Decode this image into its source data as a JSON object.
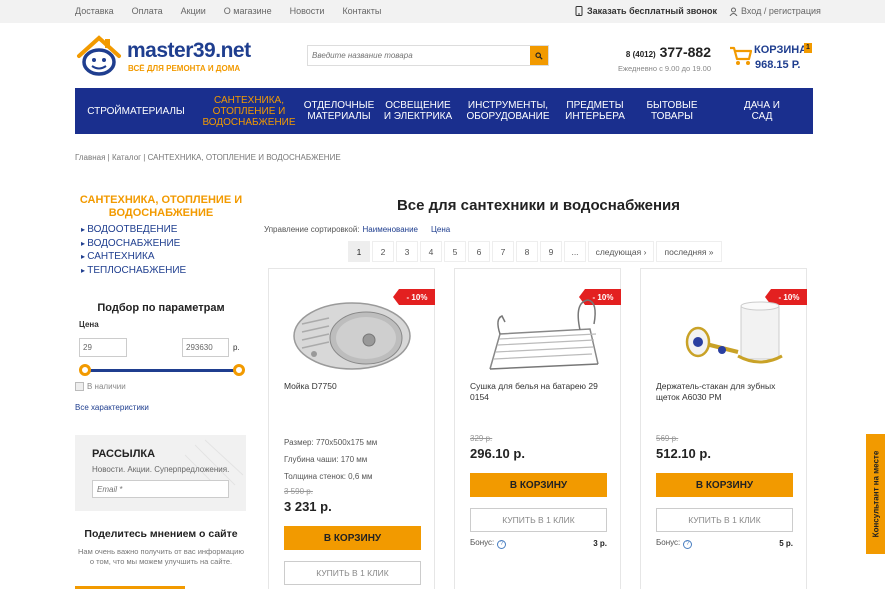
{
  "topbar": {
    "nav": [
      "Доставка",
      "Оплата",
      "Акции",
      "О магазине",
      "Новости",
      "Контакты"
    ],
    "callback_label": "Заказать бесплатный звонок",
    "login_label": "Вход / регистрация"
  },
  "header": {
    "logo_name": "master39.net",
    "logo_tagline": "ВСЁ ДЛЯ РЕМОНТА И ДОМА",
    "search_placeholder": "Введите название товара",
    "phone_code": "8 (4012)",
    "phone_number": "377-882",
    "phone_hours": "Ежедневно с 9.00 до 19.00",
    "cart_label": "КОРЗИНА",
    "cart_count": "1",
    "cart_sum": "968.15 Р."
  },
  "menu": [
    {
      "label": "СТРОЙМАТЕРИАЛЫ",
      "active": false
    },
    {
      "label": "САНТЕХНИКА, ОТОПЛЕНИЕ И ВОДОСНАБЖЕНИЕ",
      "active": true
    },
    {
      "label": "ОТДЕЛОЧНЫЕ МАТЕРИАЛЫ",
      "active": false
    },
    {
      "label": "ОСВЕЩЕНИЕ И ЭЛЕКТРИКА",
      "active": false
    },
    {
      "label": "ИНСТРУМЕНТЫ, ОБОРУДОВАНИЕ",
      "active": false
    },
    {
      "label": "ПРЕДМЕТЫ ИНТЕРЬЕРА",
      "active": false
    },
    {
      "label": "БЫТОВЫЕ ТОВАРЫ",
      "active": false
    },
    {
      "label": "ДАЧА И САД",
      "active": false
    }
  ],
  "breadcrumbs": "Главная | Каталог | САНТЕХНИКА, ОТОПЛЕНИЕ И ВОДОСНАБЖЕНИЕ",
  "sidebar": {
    "category_title": "САНТЕХНИКА, ОТОПЛЕНИЕ И ВОДОСНАБЖЕНИЕ",
    "subcategories": [
      "ВОДООТВЕДЕНИЕ",
      "ВОДОСНАБЖЕНИЕ",
      "САНТЕХНИКА",
      "ТЕПЛОСНАБЖЕНИЕ"
    ],
    "filter_title": "Подбор по параметрам",
    "price_label": "Цена",
    "price_min": "29",
    "price_max": "293630",
    "currency": "р.",
    "in_stock_label": "В наличии",
    "all_chars_label": "Все характеристики",
    "newsletter_title": "РАССЫЛКА",
    "newsletter_text": "Новости. Акции. Суперпредложения.",
    "newsletter_placeholder": "Email *",
    "opinion_title": "Поделитесь мнением о сайте",
    "opinion_text": "Нам очень важно получить от вас информацию о том, что мы можем улучшить на сайте."
  },
  "content": {
    "title": "Все для сантехники и водоснабжения",
    "sort_label": "Управление сортировкой:",
    "sort_options": [
      "Наименование",
      "Цена"
    ],
    "pages": [
      "1",
      "2",
      "3",
      "4",
      "5",
      "6",
      "7",
      "8",
      "9",
      "...",
      "следующая ›",
      "последняя »"
    ],
    "current_page": "1"
  },
  "products": [
    {
      "discount": "- 10%",
      "name": "Мойка D7750",
      "specs": [
        "Размер: 770х500х175 мм",
        "Глубина чаши: 170 мм",
        "Толщина стенок: 0,6 мм"
      ],
      "old_price": "3 590 р.",
      "new_price": "3 231 р.",
      "buy_label": "В КОРЗИНУ",
      "one_click_label": "КУПИТЬ В 1 КЛИК",
      "bonus_label": "",
      "bonus_value": ""
    },
    {
      "discount": "- 10%",
      "name": "Сушка для белья на батарею 29 0154",
      "specs": [],
      "old_price": "329 р.",
      "new_price": "296.10 р.",
      "buy_label": "В КОРЗИНУ",
      "one_click_label": "КУПИТЬ В 1 КЛИК",
      "bonus_label": "Бонус:",
      "bonus_value": "3 р."
    },
    {
      "discount": "- 10%",
      "name": "Держатель-стакан для зубных щеток A6030 PM",
      "specs": [],
      "old_price": "569 р.",
      "new_price": "512.10 р.",
      "buy_label": "В КОРЗИНУ",
      "one_click_label": "КУПИТЬ В 1 КЛИК",
      "bonus_label": "Бонус:",
      "bonus_value": "5 р."
    }
  ],
  "consultant_label": "Консультант на месте",
  "colors": {
    "brand_blue": "#1a2f8e",
    "accent_orange": "#f29a00",
    "discount_red": "#e32020"
  }
}
